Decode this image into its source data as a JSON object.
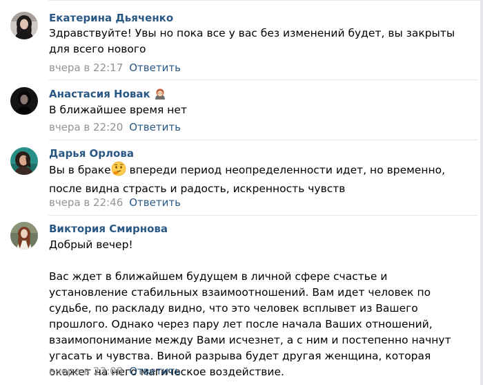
{
  "comments": [
    {
      "author": "Екатерина Дьяченко",
      "text": [
        "Здравствуйте! Увы но пока все у вас без изменений будет, вы закрыты для всего нового"
      ],
      "time": "вчера в 22:17",
      "reply": "Ответить"
    },
    {
      "author": "Анастасия Новак",
      "author_emoji": "woman-emoji-icon",
      "text": [
        "В ближайшее время нет"
      ],
      "time": "вчера в 22:20",
      "reply": "Ответить"
    },
    {
      "author": "Дарья Орлова",
      "text_before": "Вы в браке",
      "text_emoji": "thinking-face-emoji-icon",
      "text_after": " впереди период неопределенности идет, но временно, после видна страсть и радость, искренность чувств",
      "time": "вчера в 22:46",
      "reply": "Ответить"
    },
    {
      "author": "Виктория Смирнова",
      "text": [
        "Добрый вечер!",
        "Вас ждет в ближайшем будущем в личной сфере счастье и установление стабильных взаимоотношений. Вам идет человек по судьбе, по раскладу видно, что это человек всплывет из Вашего прошлого. Однако через пару лет после начала Ваших отношений, взаимопонимание между Вами исчезнет, а с ним и постепенно начнут угасать и чувства. Виной разрыва будет другая женщина, которая окажет на него магическое воздействие."
      ],
      "time": "вчера в 23:08",
      "reply": "Ответить"
    }
  ],
  "colors": {
    "link": "#2a5885",
    "meta": "#939393",
    "divider": "#e7e8ec"
  }
}
